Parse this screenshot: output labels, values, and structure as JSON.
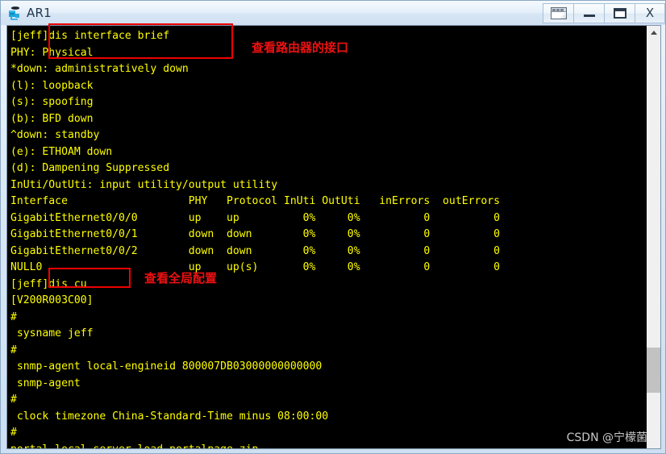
{
  "window": {
    "title": "AR1",
    "icon": "router-icon",
    "controls": [
      {
        "name": "restore-panel-button",
        "label": "",
        "icon": "panel-icon"
      },
      {
        "name": "minimize-button",
        "label": "—",
        "icon": "minimize-icon"
      },
      {
        "name": "maximize-button",
        "label": "□",
        "icon": "maximize-icon"
      },
      {
        "name": "close-button",
        "label": "X",
        "icon": "close-icon"
      }
    ]
  },
  "terminal": {
    "foreground_color": "#ffff00",
    "background_color": "#000000",
    "lines": [
      "[jeff]dis interface brief",
      "PHY: Physical",
      "*down: administratively down",
      "(l): loopback",
      "(s): spoofing",
      "(b): BFD down",
      "^down: standby",
      "(e): ETHOAM down",
      "(d): Dampening Suppressed",
      "InUti/OutUti: input utility/output utility",
      "Interface                   PHY   Protocol InUti OutUti   inErrors  outErrors",
      "GigabitEthernet0/0/0        up    up          0%     0%          0          0",
      "GigabitEthernet0/0/1        down  down        0%     0%          0          0",
      "GigabitEthernet0/0/2        down  down        0%     0%          0          0",
      "NULL0                       up    up(s)       0%     0%          0          0",
      "[jeff]dis cu",
      "[V200R003C00]",
      "#",
      " sysname jeff",
      "#",
      " snmp-agent local-engineid 800007DB03000000000000",
      " snmp-agent",
      "#",
      " clock timezone China-Standard-Time minus 08:00:00",
      "#",
      "portal local-server load portalpage.zip"
    ],
    "interface_table": {
      "columns": [
        "Interface",
        "PHY",
        "Protocol",
        "InUti",
        "OutUti",
        "inErrors",
        "outErrors"
      ],
      "rows": [
        [
          "GigabitEthernet0/0/0",
          "up",
          "up",
          "0%",
          "0%",
          "0",
          "0"
        ],
        [
          "GigabitEthernet0/0/1",
          "down",
          "down",
          "0%",
          "0%",
          "0",
          "0"
        ],
        [
          "GigabitEthernet0/0/2",
          "down",
          "down",
          "0%",
          "0%",
          "0",
          "0"
        ],
        [
          "NULL0",
          "up",
          "up(s)",
          "0%",
          "0%",
          "0",
          "0"
        ]
      ]
    }
  },
  "annotations": {
    "color": "#ee0000",
    "box1_label": "查看路由器的接口",
    "box2_label": "查看全局配置"
  },
  "scrollbar": {
    "up_arrow": "scroll-up-icon"
  },
  "watermark": {
    "text": "CSDN @宁檬菌"
  }
}
